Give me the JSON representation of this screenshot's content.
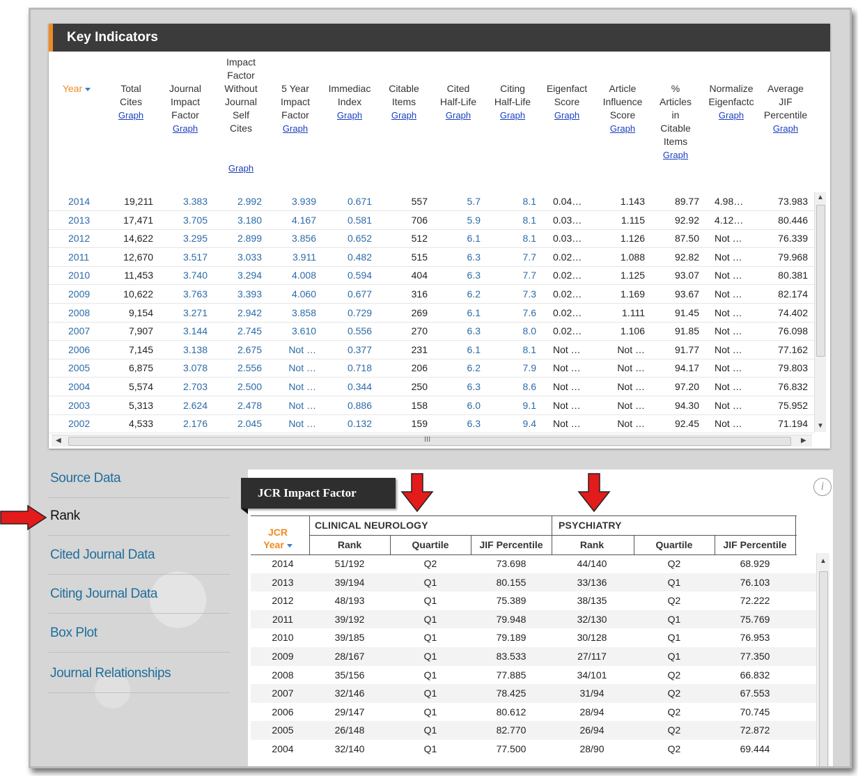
{
  "key_indicators": {
    "title": "Key Indicators",
    "graph_label": "Graph",
    "columns": [
      {
        "label": "Year",
        "graph": false
      },
      {
        "label": "Total Cites",
        "graph": true
      },
      {
        "label": "Journal Impact Factor",
        "graph": true
      },
      {
        "label": "Impact Factor Without Journal Self Cites",
        "graph": true
      },
      {
        "label": "5 Year Impact Factor",
        "graph": true
      },
      {
        "label": "Immediac Index",
        "graph": true
      },
      {
        "label": "Citable Items",
        "graph": true
      },
      {
        "label": "Cited Half-Life",
        "graph": true
      },
      {
        "label": "Citing Half-Life",
        "graph": true
      },
      {
        "label": "Eigenfact Score",
        "graph": true
      },
      {
        "label": "Article Influence Score",
        "graph": true
      },
      {
        "label": "% Articles in Citable Items",
        "graph": true
      },
      {
        "label": "Normalize Eigenfactc",
        "graph": true
      },
      {
        "label": "Average JIF Percentile",
        "graph": true
      }
    ],
    "rows": [
      [
        "2014",
        "19,211",
        "3.383",
        "2.992",
        "3.939",
        "0.671",
        "557",
        "5.7",
        "8.1",
        "0.04…",
        "1.143",
        "89.77",
        "4.98…",
        "73.983"
      ],
      [
        "2013",
        "17,471",
        "3.705",
        "3.180",
        "4.167",
        "0.581",
        "706",
        "5.9",
        "8.1",
        "0.03…",
        "1.115",
        "92.92",
        "4.12…",
        "80.446"
      ],
      [
        "2012",
        "14,622",
        "3.295",
        "2.899",
        "3.856",
        "0.652",
        "512",
        "6.1",
        "8.1",
        "0.03…",
        "1.126",
        "87.50",
        "Not …",
        "76.339"
      ],
      [
        "2011",
        "12,670",
        "3.517",
        "3.033",
        "3.911",
        "0.482",
        "515",
        "6.3",
        "7.7",
        "0.02…",
        "1.088",
        "92.82",
        "Not …",
        "79.968"
      ],
      [
        "2010",
        "11,453",
        "3.740",
        "3.294",
        "4.008",
        "0.594",
        "404",
        "6.3",
        "7.7",
        "0.02…",
        "1.125",
        "93.07",
        "Not …",
        "80.381"
      ],
      [
        "2009",
        "10,622",
        "3.763",
        "3.393",
        "4.060",
        "0.677",
        "316",
        "6.2",
        "7.3",
        "0.02…",
        "1.169",
        "93.67",
        "Not …",
        "82.174"
      ],
      [
        "2008",
        "9,154",
        "3.271",
        "2.942",
        "3.858",
        "0.729",
        "269",
        "6.1",
        "7.6",
        "0.02…",
        "1.111",
        "91.45",
        "Not …",
        "74.402"
      ],
      [
        "2007",
        "7,907",
        "3.144",
        "2.745",
        "3.610",
        "0.556",
        "270",
        "6.3",
        "8.0",
        "0.02…",
        "1.106",
        "91.85",
        "Not …",
        "76.098"
      ],
      [
        "2006",
        "7,145",
        "3.138",
        "2.675",
        "Not …",
        "0.377",
        "231",
        "6.1",
        "8.1",
        "Not …",
        "Not …",
        "91.77",
        "Not …",
        "77.162"
      ],
      [
        "2005",
        "6,875",
        "3.078",
        "2.556",
        "Not …",
        "0.718",
        "206",
        "6.2",
        "7.9",
        "Not …",
        "Not …",
        "94.17",
        "Not …",
        "79.803"
      ],
      [
        "2004",
        "5,574",
        "2.703",
        "2.500",
        "Not …",
        "0.344",
        "250",
        "6.3",
        "8.6",
        "Not …",
        "Not …",
        "97.20",
        "Not …",
        "76.832"
      ],
      [
        "2003",
        "5,313",
        "2.624",
        "2.478",
        "Not …",
        "0.886",
        "158",
        "6.0",
        "9.1",
        "Not …",
        "Not …",
        "94.30",
        "Not …",
        "75.952"
      ],
      [
        "2002",
        "4,533",
        "2.176",
        "2.045",
        "Not …",
        "0.132",
        "159",
        "6.3",
        "9.4",
        "Not …",
        "Not …",
        "92.45",
        "Not …",
        "71.194"
      ]
    ],
    "hscroll_grip": "III"
  },
  "sidebar": {
    "items": [
      {
        "label": "Source Data",
        "active": false
      },
      {
        "label": "Rank",
        "active": true
      },
      {
        "label": "Cited Journal Data",
        "active": false
      },
      {
        "label": "Citing Journal Data",
        "active": false
      },
      {
        "label": "Box Plot",
        "active": false
      },
      {
        "label": "Journal Relationships",
        "active": false
      }
    ]
  },
  "rank": {
    "tab_title": "JCR Impact Factor",
    "info_icon": "i",
    "year_header_line1": "JCR",
    "year_header_line2": "Year",
    "groups": [
      {
        "name": "CLINICAL NEUROLOGY",
        "columns": [
          "Rank",
          "Quartile",
          "JIF Percentile"
        ]
      },
      {
        "name": "PSYCHIATRY",
        "columns": [
          "Rank",
          "Quartile",
          "JIF Percentile"
        ]
      }
    ],
    "rows": [
      [
        "2014",
        "51/192",
        "Q2",
        "73.698",
        "44/140",
        "Q2",
        "68.929"
      ],
      [
        "2013",
        "39/194",
        "Q1",
        "80.155",
        "33/136",
        "Q1",
        "76.103"
      ],
      [
        "2012",
        "48/193",
        "Q1",
        "75.389",
        "38/135",
        "Q2",
        "72.222"
      ],
      [
        "2011",
        "39/192",
        "Q1",
        "79.948",
        "32/130",
        "Q1",
        "75.769"
      ],
      [
        "2010",
        "39/185",
        "Q1",
        "79.189",
        "30/128",
        "Q1",
        "76.953"
      ],
      [
        "2009",
        "28/167",
        "Q1",
        "83.533",
        "27/117",
        "Q1",
        "77.350"
      ],
      [
        "2008",
        "35/156",
        "Q1",
        "77.885",
        "34/101",
        "Q2",
        "66.832"
      ],
      [
        "2007",
        "32/146",
        "Q1",
        "78.425",
        "31/94",
        "Q2",
        "67.553"
      ],
      [
        "2006",
        "29/147",
        "Q1",
        "80.612",
        "28/94",
        "Q2",
        "70.745"
      ],
      [
        "2005",
        "26/148",
        "Q1",
        "82.770",
        "26/94",
        "Q2",
        "72.872"
      ],
      [
        "2004",
        "32/140",
        "Q1",
        "77.500",
        "28/90",
        "Q2",
        "69.444"
      ]
    ]
  },
  "colors": {
    "accent": "#f08a24",
    "header_bg": "#3b3b3b",
    "link_blue": "#1f6e9b",
    "arrow_red": "#e31b1b"
  }
}
